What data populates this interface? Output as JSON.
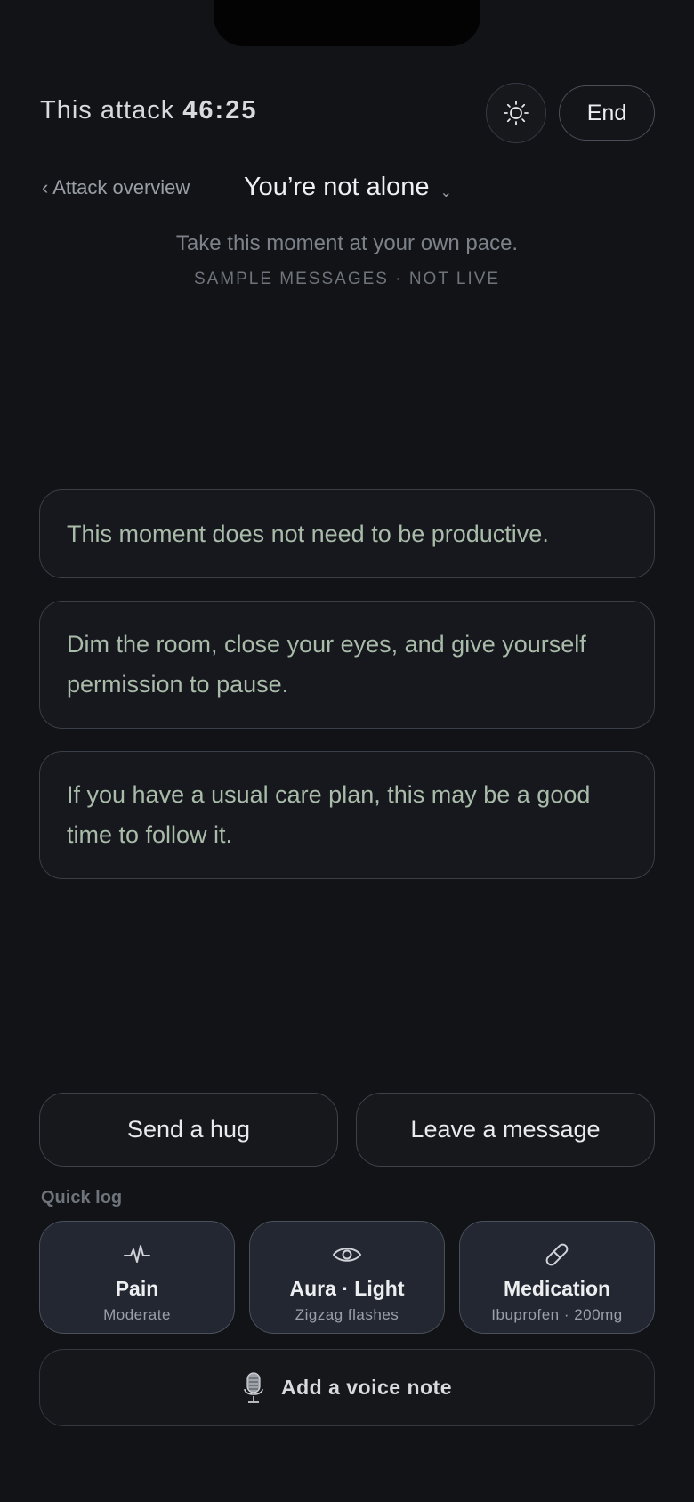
{
  "header": {
    "timer_label": "This attack",
    "timer_value": "46:25",
    "end_label": "End",
    "theme_icon": "sun-icon"
  },
  "nav": {
    "back_label": "‹ Attack overview",
    "channel_title": "You’re not alone",
    "channel_chevron": "⌄"
  },
  "intro": {
    "subtitle": "Take this moment at your own pace.",
    "sample_note": "SAMPLE MESSAGES · NOT LIVE"
  },
  "messages": [
    "This moment does not need to be productive.",
    "Dim the room, close your eyes, and give yourself permission to pause.",
    "If you have a usual care plan, this may be a good time to follow it."
  ],
  "actions": {
    "hug_label": "Send a hug",
    "message_label": "Leave a message"
  },
  "quick_log": {
    "label": "Quick log",
    "items": [
      {
        "icon": "pulse-icon",
        "title": "Pain",
        "subtitle": "Moderate"
      },
      {
        "icon": "eye-icon",
        "title": "Aura · Light",
        "subtitle": "Zigzag flashes"
      },
      {
        "icon": "pill-icon",
        "title": "Medication",
        "subtitle": "Ibuprofen · 200mg"
      }
    ]
  },
  "voice": {
    "icon": "microphone-icon",
    "label": "Add a voice note"
  },
  "colors": {
    "background": "#111317",
    "message_text": "#a9bba9",
    "card_bg": "#222731"
  }
}
